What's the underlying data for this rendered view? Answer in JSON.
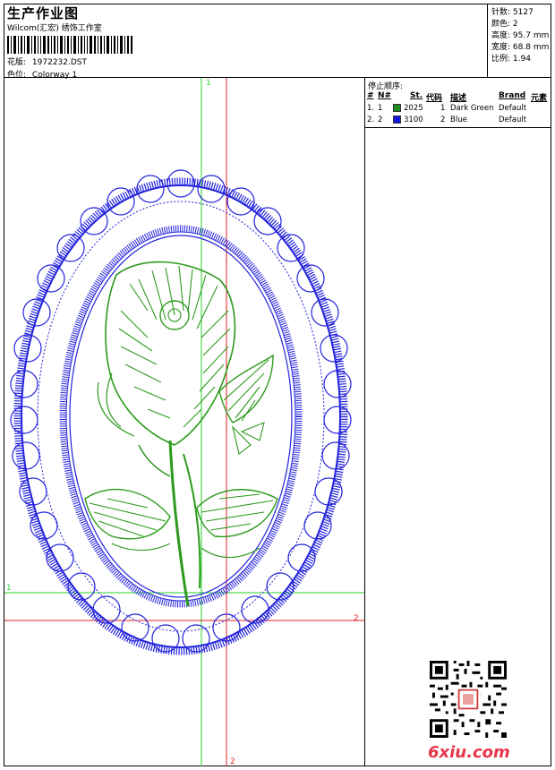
{
  "header": {
    "title": "生产作业图",
    "subtitle": "Wilcom(汇宏) 绣饰工作室",
    "design_label": "花版:",
    "design_value": "1972232.DST",
    "color_label": "色位:",
    "color_value": "Colorway 1"
  },
  "stats": [
    {
      "label": "针数:",
      "value": "5127"
    },
    {
      "label": "颜色:",
      "value": "2"
    },
    {
      "label": "高度:",
      "value": "95.7 mm"
    },
    {
      "label": "宽度:",
      "value": "68.8 mm"
    },
    {
      "label": "比例:",
      "value": "1.94"
    }
  ],
  "stop_sequence": {
    "title": "停止顺序:",
    "columns": [
      "#",
      "N#",
      "St.",
      "代码",
      "描述",
      "Brand",
      "元素"
    ],
    "rows": [
      {
        "idx": "1.",
        "n": "1",
        "code": "2025",
        "st": "1",
        "desc": "Dark Green",
        "brand": "Default",
        "color": "#1f8c1f"
      },
      {
        "idx": "2.",
        "n": "2",
        "code": "3100",
        "st": "2",
        "desc": "Blue",
        "brand": "Default",
        "color": "#1515e0"
      }
    ]
  },
  "axes": {
    "v1": "1",
    "h1": "1",
    "v2": "2",
    "h2": "2"
  },
  "watermark": "6xiu.com",
  "colors": {
    "green": "#2c9a1c",
    "blue": "#2323dd",
    "guide_green": "#2ad22a",
    "guide_red": "#e02020"
  }
}
